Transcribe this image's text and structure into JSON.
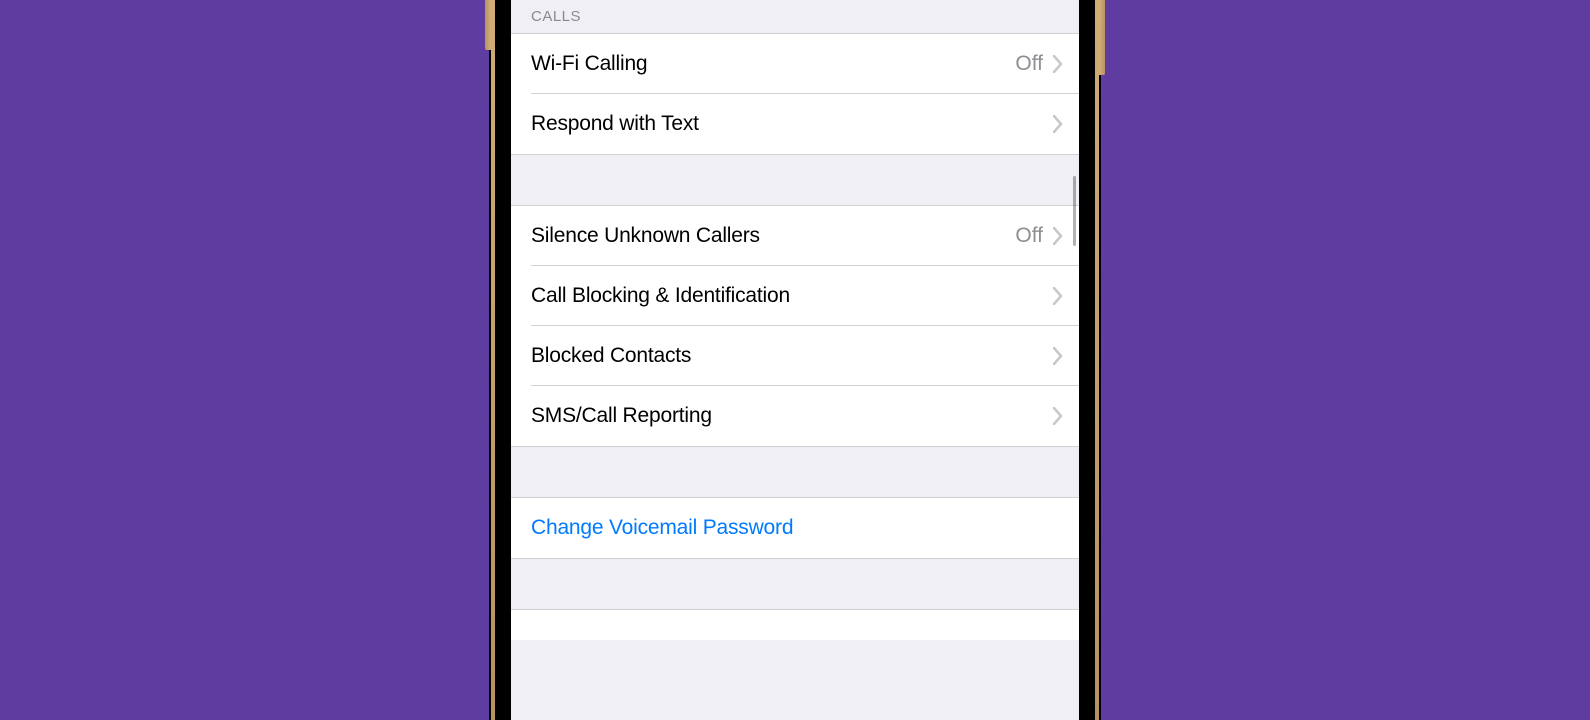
{
  "sections": {
    "calls_header": "CALLS",
    "group1": [
      {
        "label": "Wi-Fi Calling",
        "value": "Off",
        "chevron": true
      },
      {
        "label": "Respond with Text",
        "value": "",
        "chevron": true
      }
    ],
    "group2": [
      {
        "label": "Silence Unknown Callers",
        "value": "Off",
        "chevron": true
      },
      {
        "label": "Call Blocking & Identification",
        "value": "",
        "chevron": true
      },
      {
        "label": "Blocked Contacts",
        "value": "",
        "chevron": true
      },
      {
        "label": "SMS/Call Reporting",
        "value": "",
        "chevron": true
      }
    ],
    "group3": [
      {
        "action_label": "Change Voicemail Password"
      }
    ]
  }
}
